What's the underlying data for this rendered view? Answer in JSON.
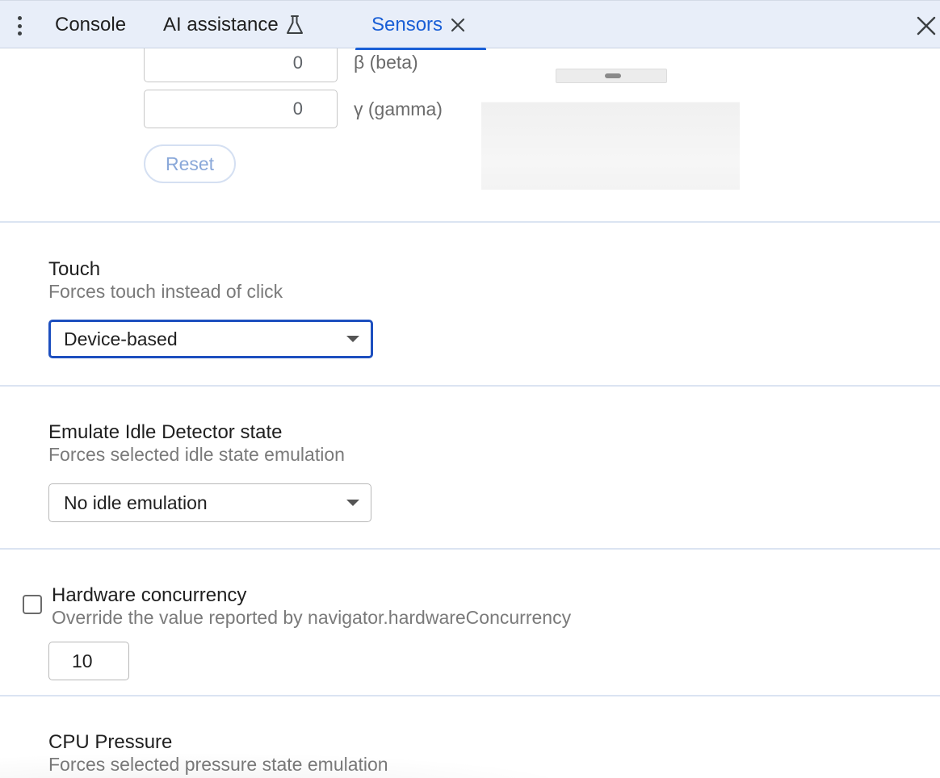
{
  "tabs": {
    "console": "Console",
    "ai_assistance": "AI assistance",
    "sensors": "Sensors"
  },
  "orientation": {
    "beta_value": "0",
    "beta_label": "β (beta)",
    "gamma_value": "0",
    "gamma_label": "γ (gamma)",
    "reset_label": "Reset"
  },
  "touch": {
    "title": "Touch",
    "description": "Forces touch instead of click",
    "selected": "Device-based"
  },
  "idle": {
    "title": "Emulate Idle Detector state",
    "description": "Forces selected idle state emulation",
    "selected": "No idle emulation"
  },
  "hardware": {
    "title": "Hardware concurrency",
    "description": "Override the value reported by navigator.hardwareConcurrency",
    "value": "10",
    "checked": false
  },
  "cpu": {
    "title": "CPU Pressure",
    "description": "Forces selected pressure state emulation"
  },
  "colors": {
    "accent": "#1a5fd6",
    "focus_border": "#1d4fbf",
    "tabbar_bg": "#e8eef9",
    "divider": "#dbe4f2"
  },
  "icons": {
    "menu": "more-vert-icon",
    "ai_badge": "flask-icon",
    "tab_close": "close-icon",
    "panel_close": "close-icon"
  }
}
